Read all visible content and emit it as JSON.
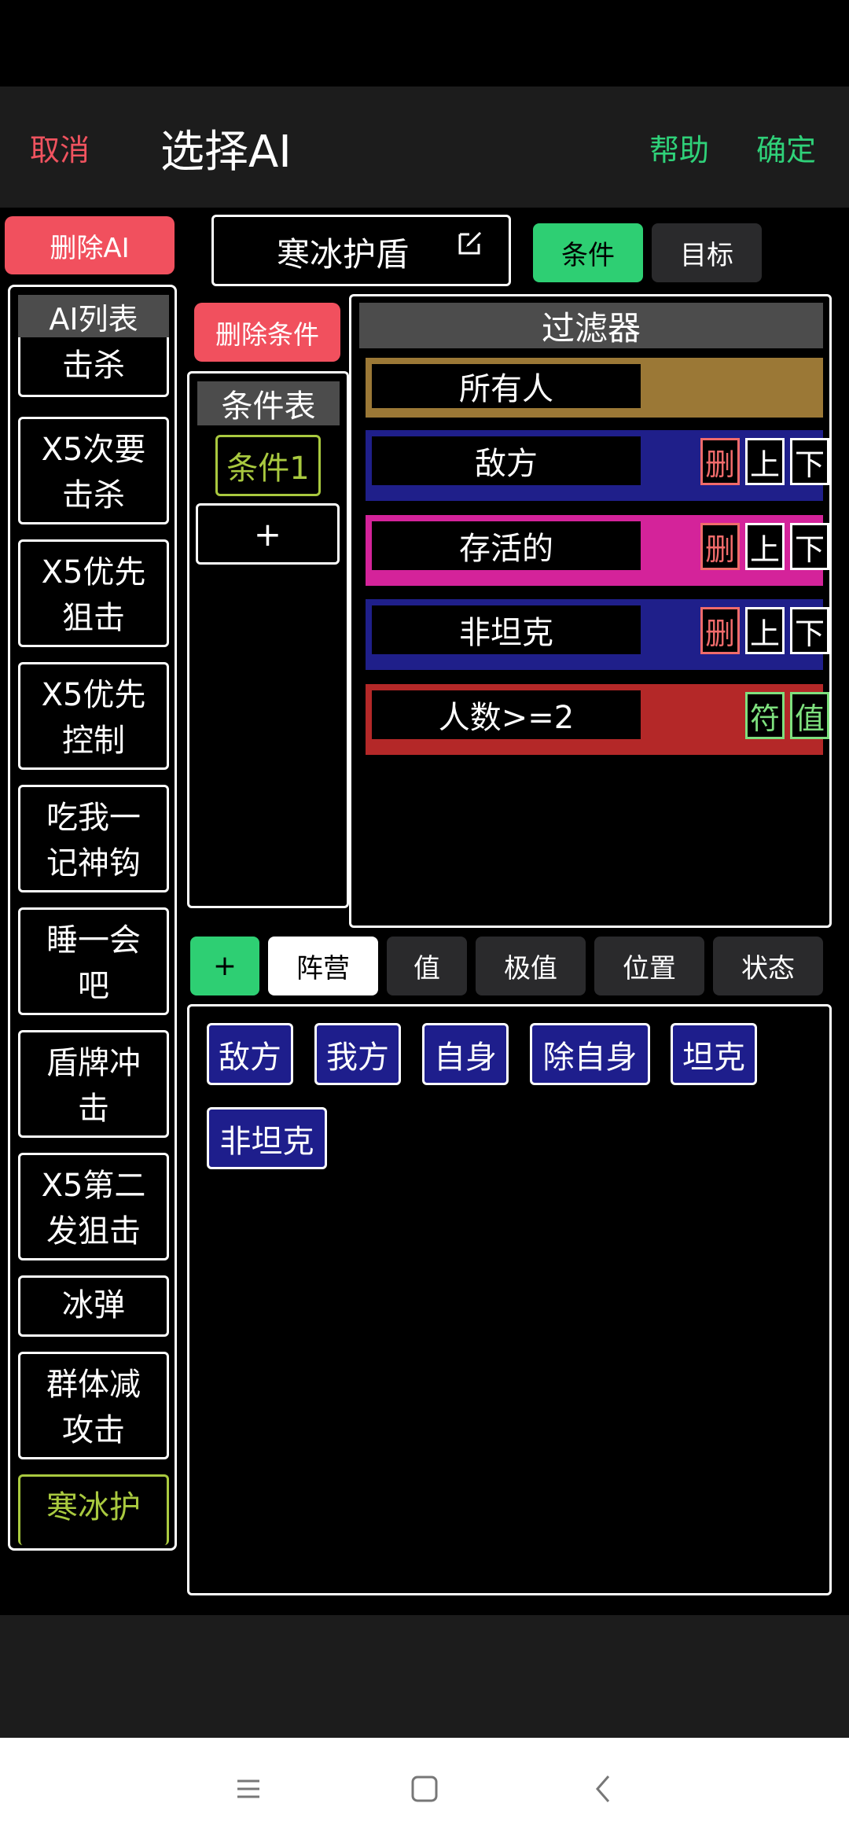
{
  "header": {
    "cancel": "取消",
    "title": "选择AI",
    "help": "帮助",
    "ok": "确定"
  },
  "delete_ai": "删除AI",
  "ai_name": "寒冰护盾",
  "tabs": {
    "condition": "条件",
    "target": "目标"
  },
  "ai_list": {
    "title": "AI列表",
    "items": [
      "击杀",
      "X5次要击杀",
      "X5优先狙击",
      "X5优先控制",
      "吃我一记神钩",
      "睡一会吧",
      "盾牌冲击",
      "X5第二发狙击",
      "冰弹",
      "群体减攻击",
      "寒冰护"
    ]
  },
  "delete_condition": "删除条件",
  "condition_list": {
    "title": "条件表",
    "items": [
      "条件1"
    ],
    "add": "+"
  },
  "filter": {
    "title": "过滤器",
    "rows": [
      {
        "label": "所有人",
        "color": "#9b7836",
        "buttons": []
      },
      {
        "label": "敌方",
        "color": "#1f1f8a",
        "buttons": [
          "删",
          "上",
          "下"
        ]
      },
      {
        "label": "存活的",
        "color": "#d4239a",
        "buttons": [
          "删",
          "上",
          "下"
        ]
      },
      {
        "label": "非坦克",
        "color": "#1f1f8a",
        "buttons": [
          "删",
          "上",
          "下"
        ]
      },
      {
        "label": "人数>=2",
        "color": "#b42828",
        "buttons": [
          "符",
          "值"
        ]
      }
    ]
  },
  "categories": {
    "plus": "+",
    "tabs": [
      "阵营",
      "值",
      "极值",
      "位置",
      "状态"
    ],
    "active": "阵营"
  },
  "options": [
    "敌方",
    "我方",
    "自身",
    "除自身",
    "坦克",
    "非坦克"
  ],
  "colors": {
    "red": "#f1505e",
    "green": "#2ecf73",
    "olive": "#a9c93f",
    "blue": "#1e1e8c"
  }
}
